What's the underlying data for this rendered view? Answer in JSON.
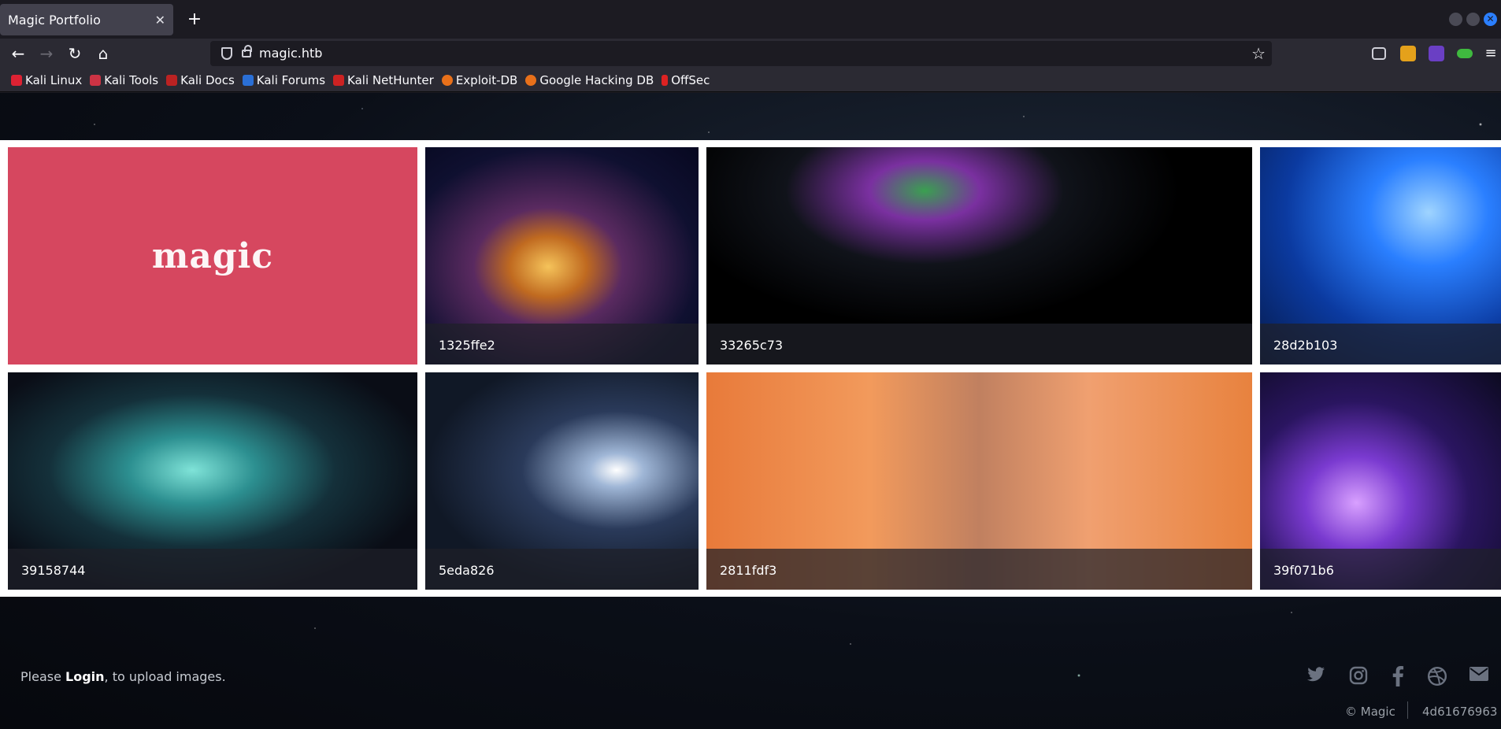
{
  "browser": {
    "tab_title": "Magic Portfolio",
    "url": "magic.htb",
    "bookmarks": [
      "Kali Linux",
      "Kali Tools",
      "Kali Docs",
      "Kali Forums",
      "Kali NetHunter",
      "Exploit-DB",
      "Google Hacking DB",
      "OffSec"
    ],
    "colors": {
      "chrome": "#2b2a33",
      "tabstrip": "#1c1b22",
      "active_tab": "#42414d"
    }
  },
  "hero": {
    "logo_text": "magic"
  },
  "gallery": {
    "row1": [
      "1325ffe2",
      "33265c73",
      "28d2b103"
    ],
    "row2": [
      "39158744",
      "5eda826",
      "2811fdf3",
      "39f071b6"
    ]
  },
  "footer": {
    "prefix": "Please ",
    "login_label": "Login",
    "suffix": ", to upload images.",
    "copyright": "© Magic",
    "hash": "4d61676963",
    "social_icons": [
      "twitter-icon",
      "instagram-icon",
      "facebook-icon",
      "dribbble-icon",
      "email-icon"
    ]
  },
  "colors": {
    "logo_tile": "#d6475f",
    "page_bg": "#0b0f18",
    "gallery_bg": "#ffffff"
  }
}
